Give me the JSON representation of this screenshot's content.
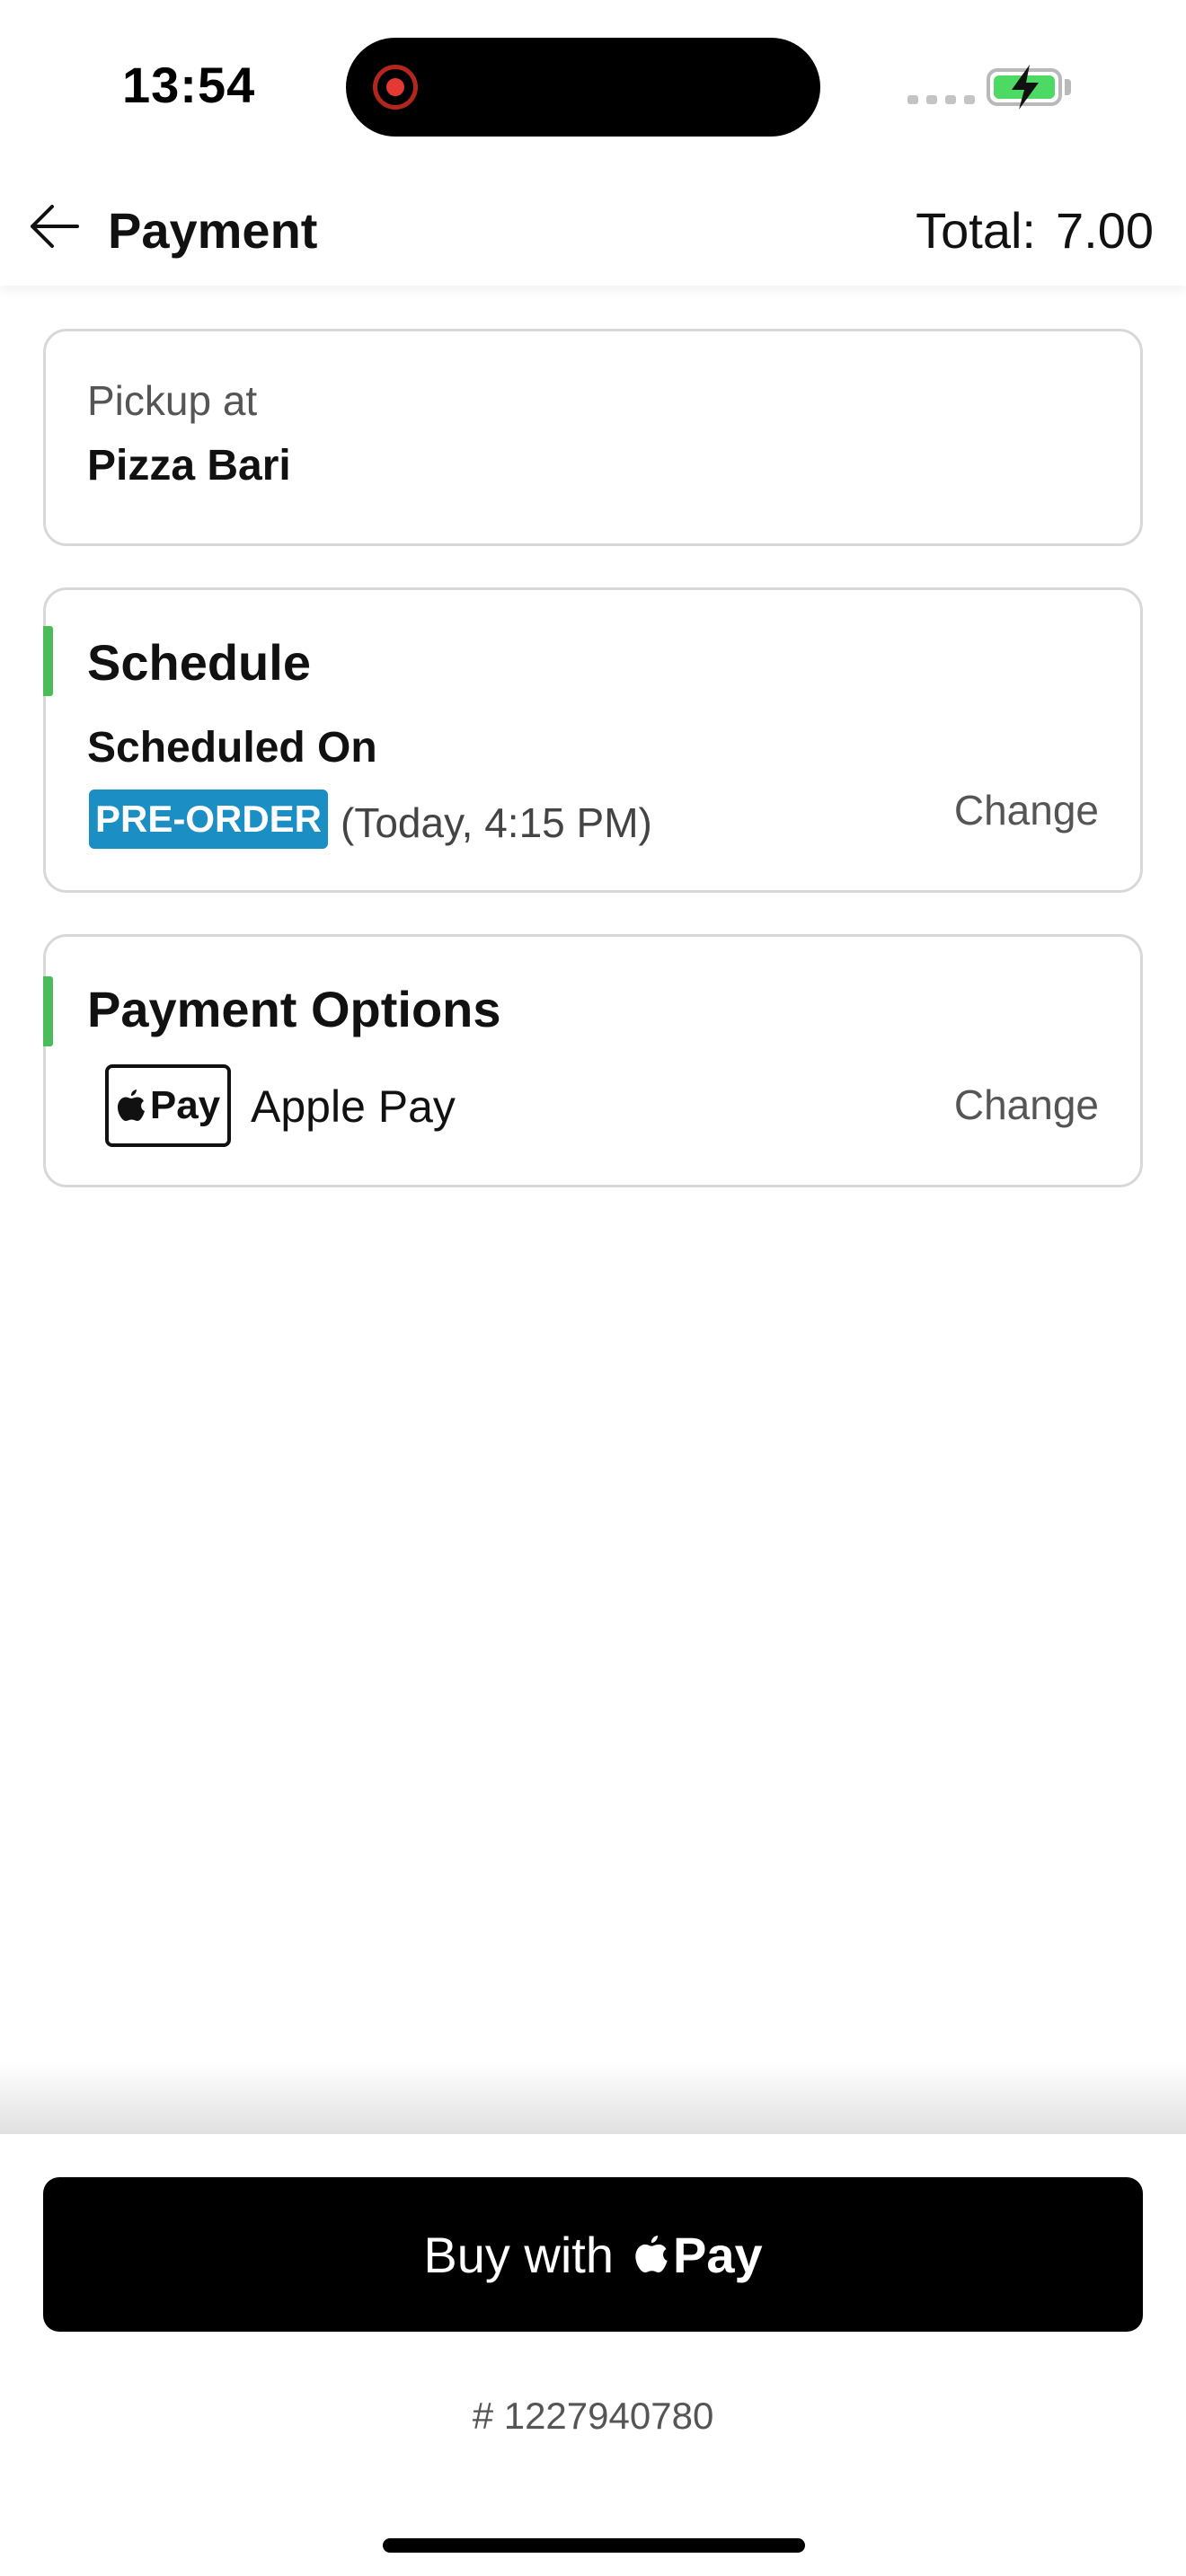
{
  "status_bar": {
    "time": "13:54",
    "icons": [
      "screen-recording-icon",
      "signal-dots-icon",
      "battery-charging-icon"
    ],
    "battery_color": "#4cd964"
  },
  "header": {
    "back_icon": "arrow-left-icon",
    "title": "Payment",
    "total_label": "Total:",
    "total_value": "7.00"
  },
  "pickup": {
    "label": "Pickup at",
    "location": "Pizza Bari"
  },
  "schedule": {
    "title": "Schedule",
    "scheduled_label": "Scheduled On",
    "badge": "PRE-ORDER",
    "badge_color": "#1b8ec3",
    "time": "(Today, 4:15 PM)",
    "change_label": "Change"
  },
  "payment": {
    "title": "Payment Options",
    "mark_text": "Pay",
    "method": "Apple Pay",
    "change_label": "Change"
  },
  "footer": {
    "buy_label": "Buy with",
    "buy_pay_text": "Pay",
    "order_number": "# 1227940780"
  },
  "colors": {
    "accent_green": "#4cbb5a",
    "button_bg": "#000000"
  }
}
